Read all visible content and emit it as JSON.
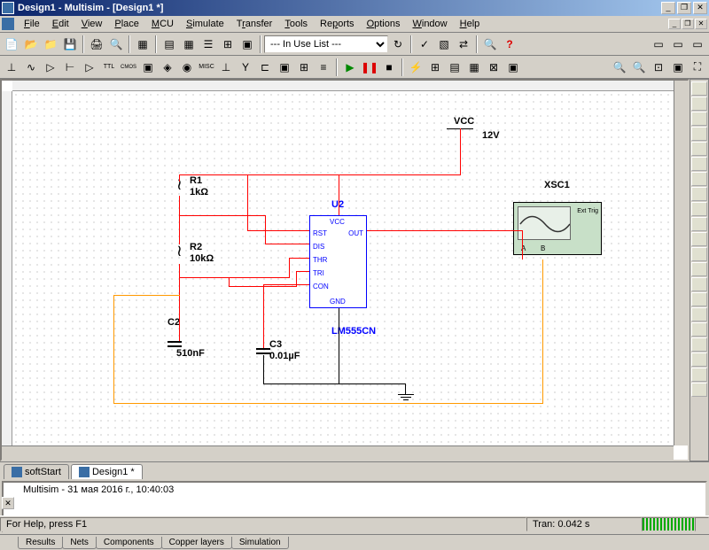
{
  "window": {
    "title": "Design1 - Multisim - [Design1 *]"
  },
  "menu": [
    "File",
    "Edit",
    "View",
    "Place",
    "MCU",
    "Simulate",
    "Transfer",
    "Tools",
    "Reports",
    "Options",
    "Window",
    "Help"
  ],
  "dropdowns": {
    "in_use": "--- In Use List ---"
  },
  "circuit": {
    "vcc_label": "VCC",
    "vcc_value": "12V",
    "r1_name": "R1",
    "r1_value": "1kΩ",
    "r2_name": "R2",
    "r2_value": "10kΩ",
    "c2_name": "C2",
    "c2_value": "510nF",
    "c3_name": "C3",
    "c3_value": "0.01µF",
    "u2_name": "U2",
    "u2_part": "LM555CN",
    "scope_name": "XSC1",
    "scope_trig": "Ext Trig",
    "scope_a": "A",
    "scope_b": "B",
    "ic_pins": {
      "vcc": "VCC",
      "rst": "RST",
      "dis": "DIS",
      "thr": "THR",
      "tri": "TRI",
      "con": "CON",
      "out": "OUT",
      "gnd": "GND"
    }
  },
  "file_tabs": {
    "tab1": "softStart",
    "tab2": "Design1 *"
  },
  "output": {
    "text": "Multisim  -  31 мая 2016 г., 10:40:03",
    "tabs": [
      "Results",
      "Nets",
      "Components",
      "Copper layers",
      "Simulation"
    ]
  },
  "status": {
    "help": "For Help, press F1",
    "tran": "Tran: 0.042 s"
  }
}
